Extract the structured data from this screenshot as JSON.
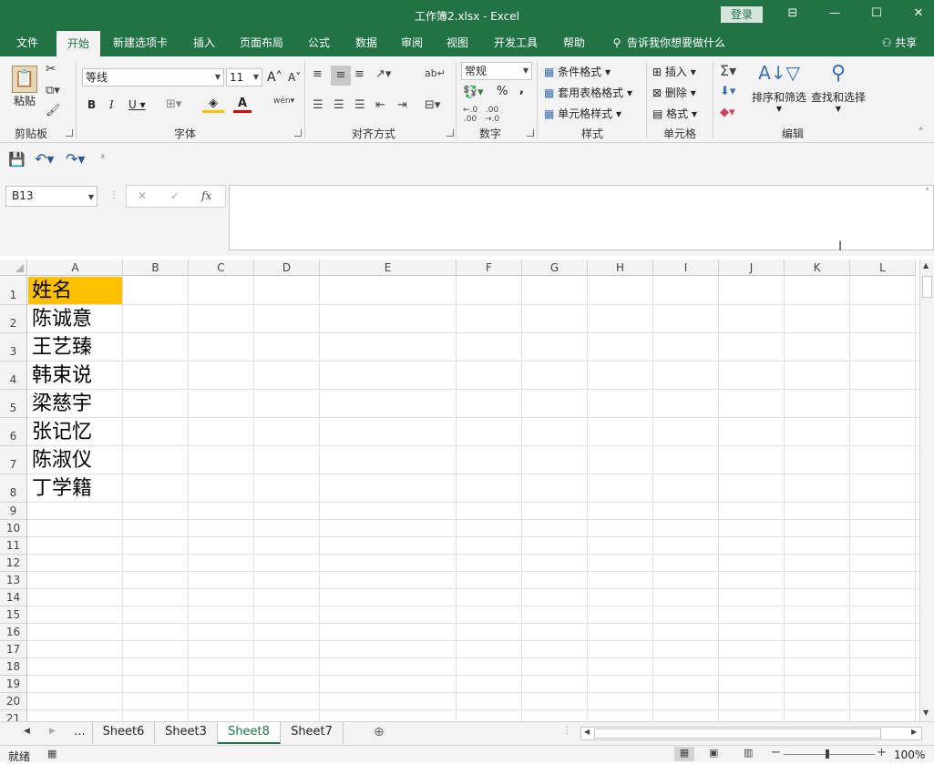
{
  "window": {
    "title": "工作簿2.xlsx  -  Excel",
    "login_label": "登录",
    "controls": [
      "⊟",
      "—",
      "☐",
      "✕"
    ]
  },
  "tabs": [
    {
      "label": "文件"
    },
    {
      "label": "开始"
    },
    {
      "label": "新建选项卡"
    },
    {
      "label": "插入"
    },
    {
      "label": "页面布局"
    },
    {
      "label": "公式"
    },
    {
      "label": "数据"
    },
    {
      "label": "审阅"
    },
    {
      "label": "视图"
    },
    {
      "label": "开发工具"
    },
    {
      "label": "帮助"
    }
  ],
  "tell_me": "告诉我你想要做什么",
  "share_label": "共享",
  "ribbon": {
    "clipboard": {
      "paste_label": "粘贴",
      "group_label": "剪贴板"
    },
    "font": {
      "name": "等线",
      "size": "11",
      "group_label": "字体",
      "bold": "B",
      "italic": "I",
      "underline": "U",
      "grow": "A",
      "shrink": "A",
      "phonetic": "wén"
    },
    "alignment": {
      "group_label": "对齐方式"
    },
    "number": {
      "format": "常规",
      "group_label": "数字",
      "percent": "%",
      "comma": ","
    },
    "styles": {
      "conditional": "条件格式",
      "table": "套用表格格式",
      "cell": "单元格样式",
      "group_label": "样式"
    },
    "cells": {
      "insert": "插入",
      "delete": "删除",
      "format": "格式",
      "group_label": "单元格"
    },
    "editing": {
      "sort": "排序和筛选",
      "find": "查找和选择",
      "group_label": "编辑"
    }
  },
  "namebox": "B13",
  "columns": [
    "A",
    "B",
    "C",
    "D",
    "E",
    "F",
    "G",
    "H",
    "I",
    "J",
    "K",
    "L"
  ],
  "rows": [
    "1",
    "2",
    "3",
    "4",
    "5",
    "6",
    "7",
    "8",
    "9",
    "10",
    "11",
    "12",
    "13",
    "14",
    "15",
    "16",
    "17",
    "18",
    "19",
    "20",
    "21"
  ],
  "cells": {
    "A1": "姓名",
    "A2": "陈诚意",
    "A3": "王艺臻",
    "A4": "韩束说",
    "A5": "梁慈宇",
    "A6": "张记忆",
    "A7": "陈淑仪",
    "A8": "丁学籍"
  },
  "header_fill": "#ffc000",
  "sheets": [
    "Sheet6",
    "Sheet3",
    "Sheet8",
    "Sheet7"
  ],
  "active_sheet": "Sheet8",
  "sheet_more": "...",
  "status": {
    "ready": "就绪",
    "zoom": "100%"
  },
  "colors": {
    "brand": "#217346"
  }
}
